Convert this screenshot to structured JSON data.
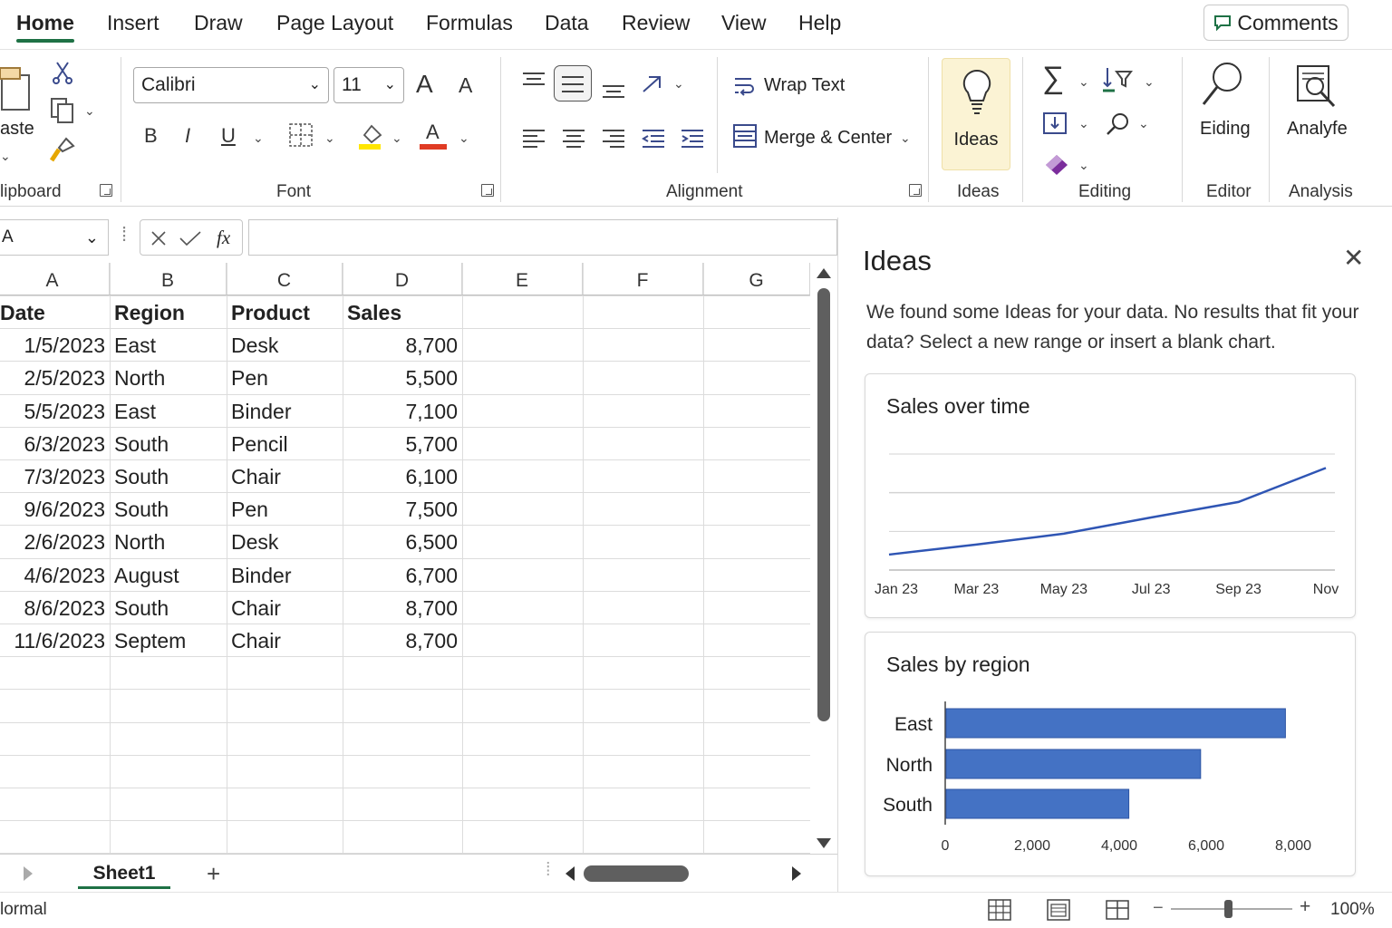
{
  "tabs": [
    {
      "label": "Home",
      "active": true
    },
    {
      "label": "Insert"
    },
    {
      "label": "Draw"
    },
    {
      "label": "Page Layout"
    },
    {
      "label": "Formulas"
    },
    {
      "label": "Data"
    },
    {
      "label": "Review"
    },
    {
      "label": "View"
    },
    {
      "label": "Help"
    }
  ],
  "comments_label": "Comments",
  "ribbon": {
    "clipboard": {
      "paste_label": "aste",
      "label": "lipboard"
    },
    "font": {
      "family": "Calibri",
      "size": "11",
      "bold": "B",
      "italic": "I",
      "underline": "U",
      "font_color_glyph": "A",
      "grow": "A",
      "shrink": "A",
      "label": "Font"
    },
    "alignment": {
      "wrap_text": "Wrap Text",
      "merge_center": "Merge & Center",
      "label": "Alignment"
    },
    "ideas": {
      "button_label": "Ideas",
      "label": "Ideas"
    },
    "editing": {
      "label": "Editing"
    },
    "editor": {
      "button_label": "Eiding",
      "label": "Editor"
    },
    "analysis": {
      "button_label": "Analyfe",
      "label": "Analysis"
    }
  },
  "accent_colors": {
    "excel_green": "#1e7145",
    "highlight_yellow": "#ffe600",
    "font_red": "#e03b24",
    "chart_blue": "#4472c4",
    "line_blue": "#2f55b4"
  },
  "formula_bar": {
    "name_box": "A",
    "fx": "fx",
    "value": ""
  },
  "grid": {
    "columns": [
      "A",
      "B",
      "C",
      "D",
      "E",
      "F",
      "G"
    ],
    "headers": [
      "Date",
      "Region",
      "Product",
      "Sales"
    ],
    "rows": [
      [
        "1/5/2023",
        "East",
        "Desk",
        "8,700"
      ],
      [
        "2/5/2023",
        "North",
        "Pen",
        "5,500"
      ],
      [
        "5/5/2023",
        "East",
        "Binder",
        "7,100"
      ],
      [
        "6/3/2023",
        "South",
        "Pencil",
        "5,700"
      ],
      [
        "7/3/2023",
        "South",
        "Chair",
        "6,100"
      ],
      [
        "9/6/2023",
        "South",
        "Pen",
        "7,500"
      ],
      [
        "2/6/2023",
        "North",
        "Desk",
        "6,500"
      ],
      [
        "4/6/2023",
        "August",
        "Binder",
        "6,700"
      ],
      [
        "8/6/2023",
        "South",
        "Chair",
        "8,700"
      ],
      [
        "11/6/2023",
        "Septem",
        "Chair",
        "8,700"
      ]
    ]
  },
  "sheet_tab": "Sheet1",
  "add_sheet": "+",
  "status": {
    "mode": "lormal",
    "zoom": "100%",
    "minus": "−",
    "plus": "+"
  },
  "ideas_pane": {
    "title": "Ideas",
    "close": "✕",
    "description": "We found some Ideas for your data. No results that fit your data? Select a new range or insert a blank chart."
  },
  "chart_data": [
    {
      "type": "line",
      "title": "Sales over time",
      "x_labels": [
        "Jan 23",
        "Mar 23",
        "May 23",
        "Jul 23",
        "Sep 23",
        "Nov"
      ],
      "x": [
        0,
        1,
        2,
        3,
        4,
        5
      ],
      "values": [
        0.2,
        0.33,
        0.47,
        0.68,
        0.88,
        1.32
      ],
      "ylim": [
        0,
        1.5
      ],
      "grid": true,
      "xlabel": "",
      "ylabel": ""
    },
    {
      "type": "bar",
      "title": "Sales by region",
      "categories": [
        "East",
        "North",
        "South"
      ],
      "values": [
        7800,
        5850,
        4200
      ],
      "xlim": [
        0,
        8000
      ],
      "ticks": [
        "0",
        "2,000",
        "4,000",
        "6,000",
        "8,000"
      ],
      "tick_values": [
        0,
        2000,
        4000,
        6000,
        8000
      ],
      "xlabel": "",
      "ylabel": ""
    }
  ]
}
